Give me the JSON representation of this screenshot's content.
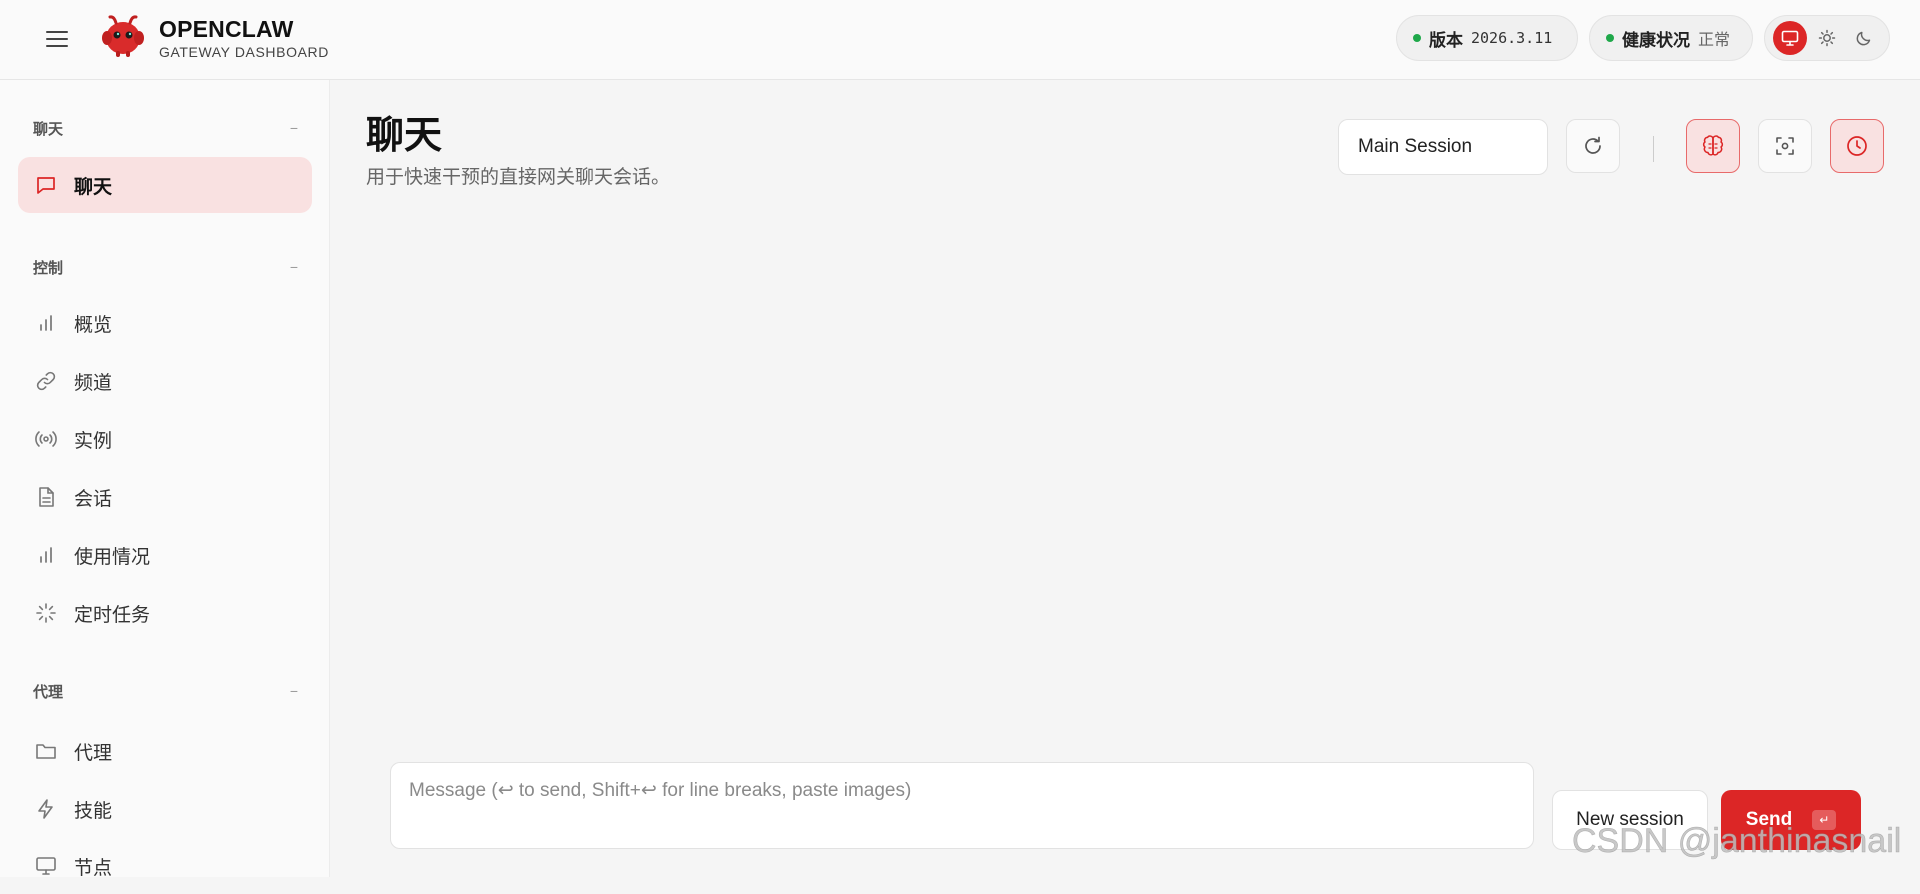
{
  "header": {
    "brand_name": "OPENCLAW",
    "brand_sub": "GATEWAY DASHBOARD",
    "version_label": "版本",
    "version_value": "2026.3.11",
    "health_label": "健康状况",
    "health_value": "正常",
    "status_color": "#1fa84a",
    "theme_options": [
      "system-icon",
      "sun-icon",
      "moon-icon"
    ],
    "theme_selected": "system-icon"
  },
  "sidebar": {
    "groups": [
      {
        "title": "聊天",
        "collapse": "−",
        "items": [
          {
            "label": "聊天",
            "icon": "chat-bubble-icon",
            "active": true
          }
        ]
      },
      {
        "title": "控制",
        "collapse": "−",
        "items": [
          {
            "label": "概览",
            "icon": "bar-chart-icon"
          },
          {
            "label": "频道",
            "icon": "link-icon"
          },
          {
            "label": "实例",
            "icon": "radio-broadcast-icon"
          },
          {
            "label": "会话",
            "icon": "document-icon"
          },
          {
            "label": "使用情况",
            "icon": "bar-chart-icon"
          },
          {
            "label": "定时任务",
            "icon": "loader-icon"
          }
        ]
      },
      {
        "title": "代理",
        "collapse": "−",
        "items": [
          {
            "label": "代理",
            "icon": "folder-icon"
          },
          {
            "label": "技能",
            "icon": "lightning-icon"
          },
          {
            "label": "节点",
            "icon": "monitor-icon"
          }
        ]
      }
    ]
  },
  "main": {
    "title": "聊天",
    "subtitle": "用于快速干预的直接网关聊天会话。",
    "session_select": "Main Session",
    "composer_placeholder": "Message (↩ to send, Shift+↩ for line breaks, paste images)",
    "new_session_label": "New session",
    "send_label": "Send",
    "send_kbd": "↵",
    "accent_color": "#dc2626"
  },
  "watermark": "CSDN @janthinasnail"
}
